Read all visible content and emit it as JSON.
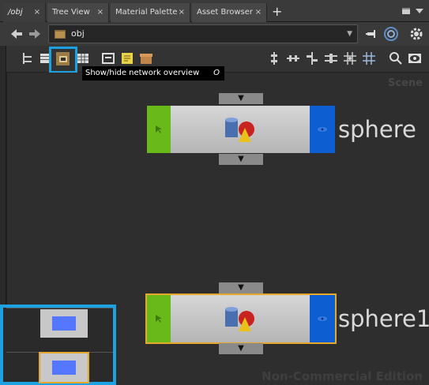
{
  "tabs": [
    {
      "label": "/obj",
      "active": true
    },
    {
      "label": "Tree View",
      "active": false
    },
    {
      "label": "Material Palette",
      "active": false
    },
    {
      "label": "Asset Browser",
      "active": false
    }
  ],
  "tab_close": "×",
  "new_tab": "+",
  "path": {
    "value": "obj",
    "dropdown": "▼"
  },
  "toolbar": {
    "icons": [
      "tree-view-icon",
      "list-view-icon",
      "network-overview-icon",
      "grid-view-icon",
      "parameter-icon",
      "sticky-note-icon",
      "network-box-icon",
      "align-vertical-icon",
      "align-horizontal-icon",
      "distribute-icon",
      "spacing-icon",
      "snap-grid-icon",
      "grid-icon",
      "zoom-icon",
      "visibility-icon"
    ]
  },
  "tooltip": {
    "text": "Show/hide network overview",
    "shortcut": "O"
  },
  "canvas": {
    "context_label": "Scene",
    "watermark": "Non-Commercial Edition"
  },
  "nodes": [
    {
      "name": "sphere",
      "selected": false,
      "connector": "▼"
    },
    {
      "name": "sphere1",
      "selected": true,
      "connector": "▼"
    }
  ],
  "colors": {
    "accent": "#1ea1e0",
    "flag": "#6ab91b",
    "display": "#0d5fd1",
    "selection": "#e6a82b"
  }
}
